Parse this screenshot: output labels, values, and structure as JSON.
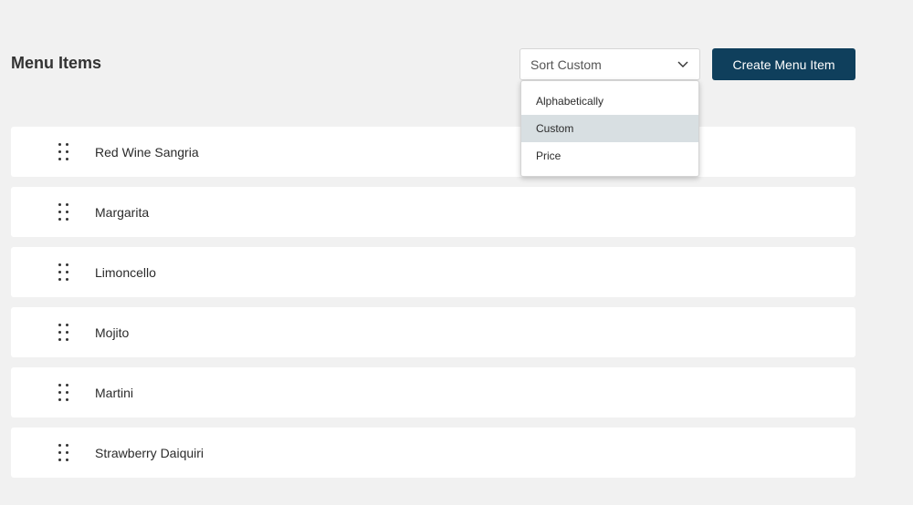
{
  "header": {
    "title": "Menu Items",
    "sort_value": "Sort Custom",
    "create_button": "Create Menu Item"
  },
  "sort_menu": {
    "options": [
      "Alphabetically",
      "Custom",
      "Price"
    ],
    "selected": "Custom"
  },
  "items": [
    {
      "name": "Red Wine Sangria"
    },
    {
      "name": "Margarita"
    },
    {
      "name": "Limoncello"
    },
    {
      "name": "Mojito"
    },
    {
      "name": "Martini"
    },
    {
      "name": "Strawberry Daiquiri"
    }
  ],
  "colors": {
    "background": "#f1f1f1",
    "primary_button": "#0f3f5c",
    "selected_option": "#d8dfe2"
  },
  "icons": {
    "sort_chevron": "chevron-down-icon",
    "row_handle": "drag-handle-icon"
  }
}
